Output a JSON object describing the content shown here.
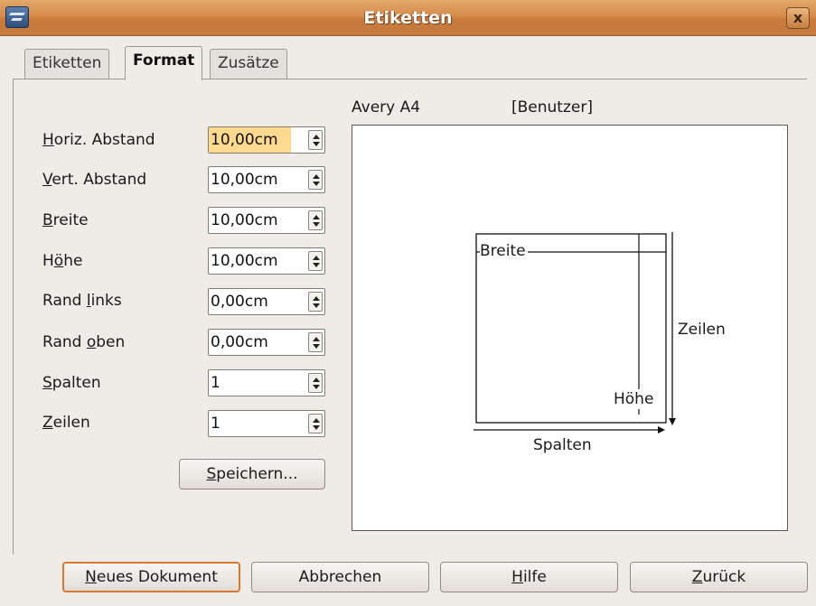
{
  "window": {
    "title": "Etiketten",
    "close_glyph": "x"
  },
  "tabs": [
    {
      "label": "Etiketten",
      "active": false
    },
    {
      "label": "Format",
      "active": true
    },
    {
      "label": "Zusätze",
      "active": false
    }
  ],
  "fields": [
    {
      "mnemonic": "H",
      "rest": "oriz. Abstand",
      "value": "10,00cm"
    },
    {
      "mnemonic": "V",
      "rest": "ert. Abstand",
      "value": "10,00cm"
    },
    {
      "mnemonic": "B",
      "rest": "reite",
      "value": "10,00cm"
    },
    {
      "pre": "H",
      "mnemonic": "ö",
      "rest": "he",
      "value": "10,00cm"
    },
    {
      "pre": "Rand ",
      "mnemonic": "l",
      "rest": "inks",
      "value": "0,00cm"
    },
    {
      "pre": "Rand ",
      "mnemonic": "o",
      "rest": "ben",
      "value": "0,00cm"
    },
    {
      "mnemonic": "S",
      "rest": "palten",
      "value": "1"
    },
    {
      "mnemonic": "Z",
      "rest": "eilen",
      "value": "1"
    }
  ],
  "save_button": {
    "mnemonic": "S",
    "rest": "peichern..."
  },
  "preview": {
    "brand": "Avery A4",
    "type": "[Benutzer]",
    "width_label": "Breite",
    "height_label": "Höhe",
    "rows_label": "Zeilen",
    "cols_label": "Spalten"
  },
  "buttons": {
    "new_doc": {
      "mnemonic": "N",
      "rest": "eues Dokument"
    },
    "cancel": {
      "label": "Abbrechen"
    },
    "help": {
      "mnemonic": "H",
      "rest": "ilfe"
    },
    "back": {
      "mnemonic": "Z",
      "rest": "urück"
    }
  }
}
